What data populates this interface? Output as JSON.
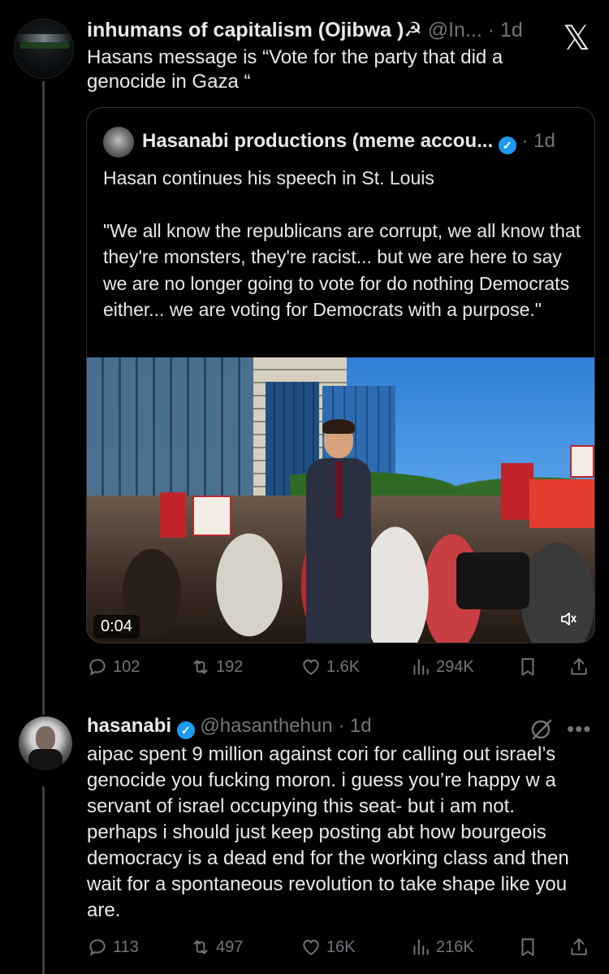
{
  "tweet1": {
    "display_name": "inhumans of capitalism (Ojibwa )",
    "name_emojis": "☭",
    "handle": "@In...",
    "separator": "·",
    "time": "1d",
    "text": "Hasans message is “Vote for the party  that did a genocide in Gaza “"
  },
  "quote": {
    "display_name": "Hasanabi productions (meme accou...",
    "separator": "·",
    "time": "1d",
    "paragraph1": "Hasan continues his speech in St. Louis",
    "paragraph2": "\"We all know the republicans are corrupt, we all know that they're monsters, they're racist... but we are here to say we are no longer going to vote for do nothing Democrats either... we are voting for Democrats with a purpose.\"",
    "video_time": "0:04"
  },
  "tweet1_actions": {
    "replies": "102",
    "reposts": "192",
    "likes": "1.6K",
    "views": "294K"
  },
  "tweet2": {
    "display_name": "hasanabi",
    "handle": "@hasanthehun",
    "separator": "·",
    "time": "1d",
    "text": "aipac spent 9 million against cori for calling out israel’s genocide you fucking moron. i guess you’re happy w a servant of israel occupying this seat- but i am not. perhaps i should just keep posting abt how bourgeois democracy is a dead end for the working class and then wait for a spontaneous revolution to take shape like you are."
  },
  "tweet2_actions": {
    "replies": "113",
    "reposts": "497",
    "likes": "16K",
    "views": "216K"
  },
  "icons": {
    "x_logo": "𝕏",
    "more": "•••",
    "verified_check": "✓",
    "mute": "🔇"
  },
  "colors": {
    "background": "#000000",
    "text": "#e7e9ea",
    "muted": "#71767b",
    "verified": "#1d9bf0",
    "border": "#2f3336"
  }
}
